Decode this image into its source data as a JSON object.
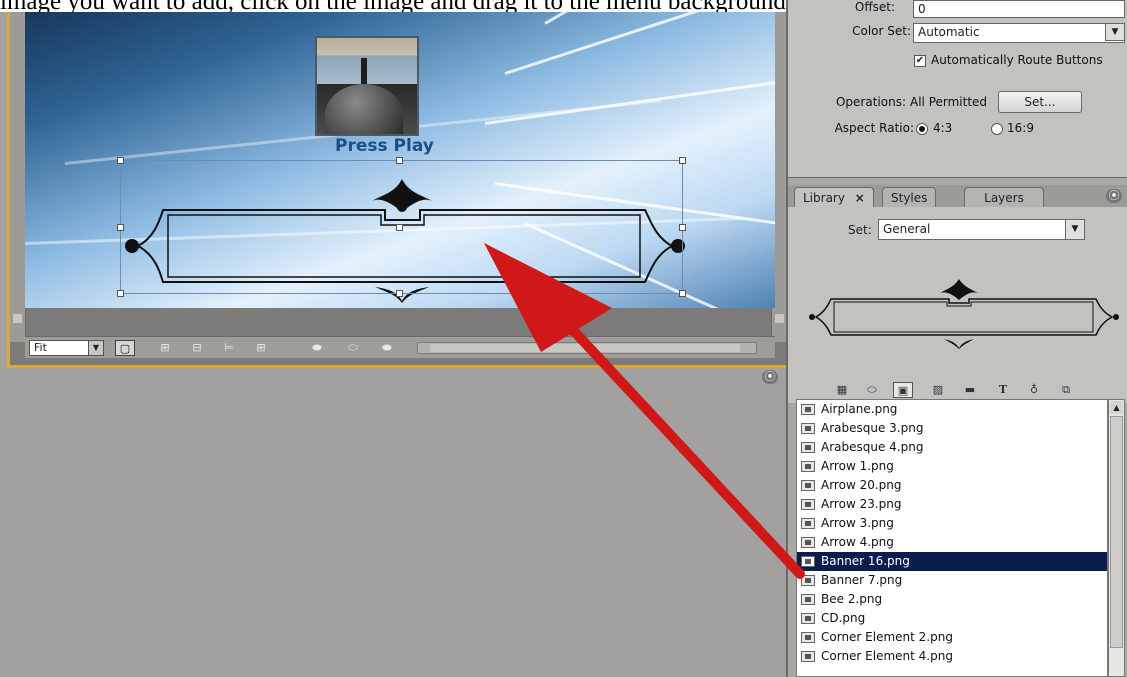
{
  "caption": "image you want to add, click on the image and drag it to the menu background.",
  "monitor": {
    "press_play": "Press Play",
    "toolbar": {
      "fit_value": "Fit",
      "icons": [
        "safe-area-icon",
        "show-hide-icon",
        "align-icon",
        "distribute-icon",
        "button-style-icon",
        "button-style-2-icon",
        "button-style-3-icon"
      ]
    }
  },
  "properties": {
    "offset_label": "Offset:",
    "offset_value": "0",
    "color_set_label": "Color Set:",
    "color_set_value": "Automatic",
    "auto_route_label": "Automatically Route Buttons",
    "auto_route_checked": true,
    "operations_label": "Operations:",
    "operations_value": "All Permitted",
    "set_button": "Set...",
    "aspect_label": "Aspect Ratio:",
    "aspect_4_3": "4:3",
    "aspect_16_9": "16:9",
    "aspect_selected": "4:3"
  },
  "library": {
    "tabs": [
      {
        "label": "Library",
        "active": true
      },
      {
        "label": "Styles",
        "active": false
      },
      {
        "label": "Layers",
        "active": false
      }
    ],
    "tab_close_glyph": "×",
    "set_label": "Set:",
    "set_value": "General",
    "files": [
      "Airplane.png",
      "Arabesque 3.png",
      "Arabesque 4.png",
      "Arrow 1.png",
      "Arrow 20.png",
      "Arrow 23.png",
      "Arrow 3.png",
      "Arrow 4.png",
      "Banner 16.png",
      "Banner 7.png",
      "Bee 2.png",
      "CD.png",
      "Corner Element 2.png",
      "Corner Element 4.png"
    ],
    "selected_file": "Banner 16.png"
  },
  "annotation": {
    "arrow_color": "#d01818",
    "highlight_color": "#0b1d4d",
    "frame_color": "#d8a93a"
  }
}
